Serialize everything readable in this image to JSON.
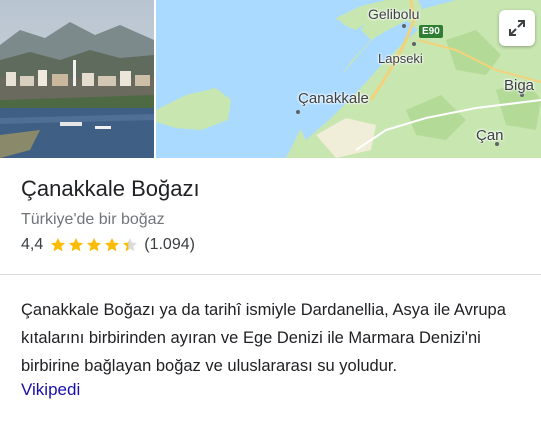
{
  "place": {
    "title": "Çanakkale Boğazı",
    "subtitle": "Türkiye'de bir boğaz",
    "rating_value": "4,4",
    "rating_stars": 4.4,
    "review_count": "(1.094)"
  },
  "description": {
    "text": "Çanakkale Boğazı ya da tarihî ismiyle Dardanellia, Asya ile Avrupa kıtalarını birbirinden ayıran ve Ege Denizi ile Marmara Denizi'ni birbirine bağlayan boğaz ve uluslararası su yoludur.",
    "source": "Vikipedi"
  },
  "map": {
    "labels": {
      "gelibolu": "Gelibolu",
      "lapseki": "Lapseki",
      "canakkale": "Çanakkale",
      "biga": "Biga",
      "can": "Çan"
    },
    "road": "E90"
  },
  "icons": {
    "expand": "expand-arrows-icon",
    "star": "star-icon"
  },
  "colors": {
    "star": "#fbbc04",
    "link": "#1a0dab",
    "sea": "#aadaff",
    "land": "#c8e6b0"
  }
}
